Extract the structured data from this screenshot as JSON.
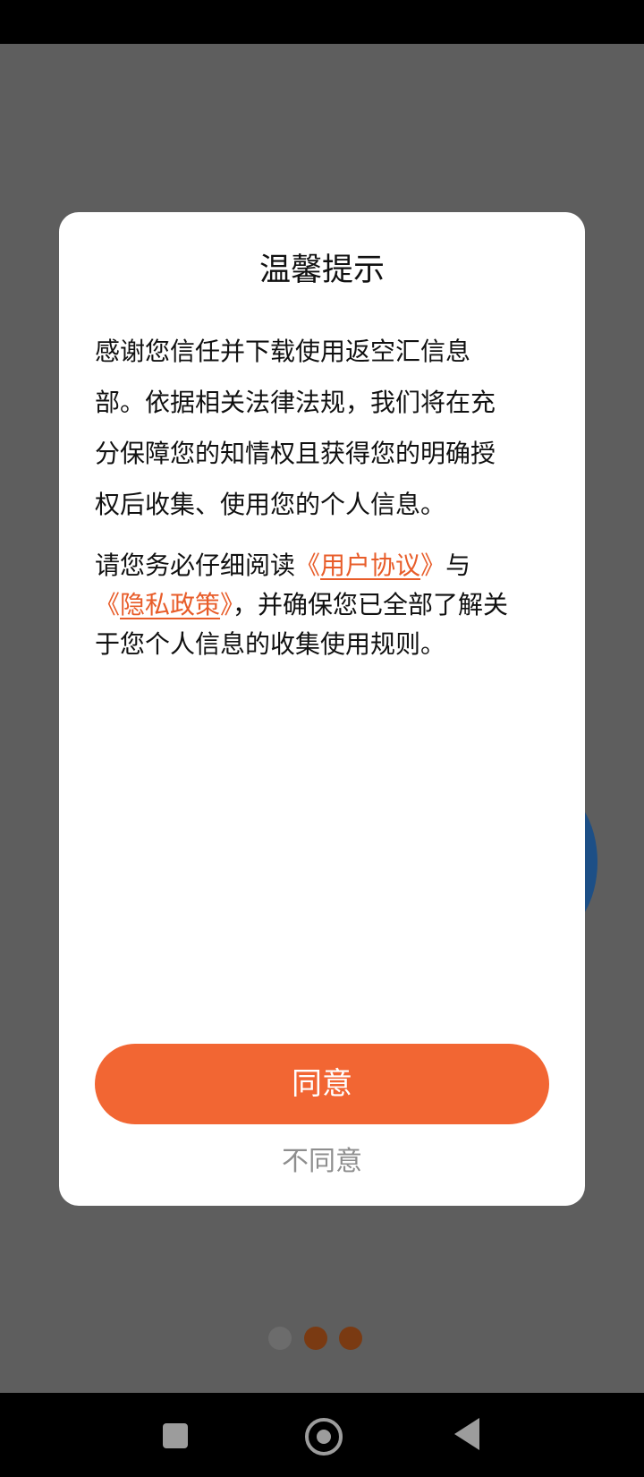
{
  "dialog": {
    "title": "温馨提示",
    "para1_lines": [
      "感谢您信任并下载使用返空汇信息",
      "部。依据相关法律法规，我们将在充",
      "分保障您的知情权且获得您的明确授",
      "权后收集、使用您的个人信息。"
    ],
    "para2": {
      "prefix": "请您务必仔细阅读",
      "link1": "用户协议",
      "middle": "与",
      "link2": "隐私政策",
      "suffix_line": "，并确保您已全部了解关",
      "last_line": "于您个人信息的收集使用规则。"
    },
    "open_quote": "《",
    "close_quote": "》",
    "agree_label": "同意",
    "disagree_label": "不同意"
  },
  "pager": {
    "count": 3,
    "active_index": 0
  },
  "colors": {
    "accent": "#f26633",
    "link": "#e85d2a",
    "overlay": "#5e5e5e",
    "disagree_text": "#8e8e8e"
  },
  "icons": [
    "recents-icon",
    "home-icon",
    "back-icon"
  ]
}
